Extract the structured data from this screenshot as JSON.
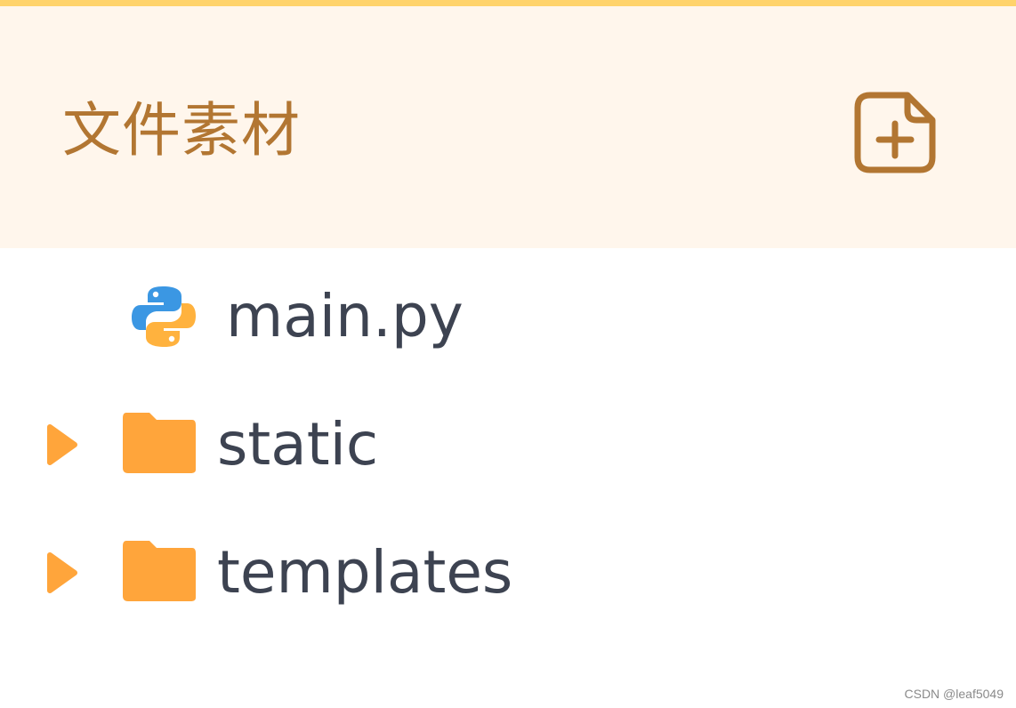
{
  "header": {
    "title": "文件素材",
    "add_icon": "add-file-icon"
  },
  "tree": {
    "items": [
      {
        "name": "main.py",
        "type": "file",
        "icon": "python-icon"
      },
      {
        "name": "static",
        "type": "folder",
        "icon": "folder-icon",
        "expandable": true
      },
      {
        "name": "templates",
        "type": "folder",
        "icon": "folder-icon",
        "expandable": true
      }
    ]
  },
  "watermark": "CSDN @leaf5049",
  "colors": {
    "accent_bar": "#ffd36b",
    "header_bg": "#fff6ec",
    "header_text": "#b27632",
    "item_text": "#3d4351",
    "folder": "#ffa53b",
    "python_blue": "#3b97e3",
    "python_yellow": "#ffb23e"
  }
}
